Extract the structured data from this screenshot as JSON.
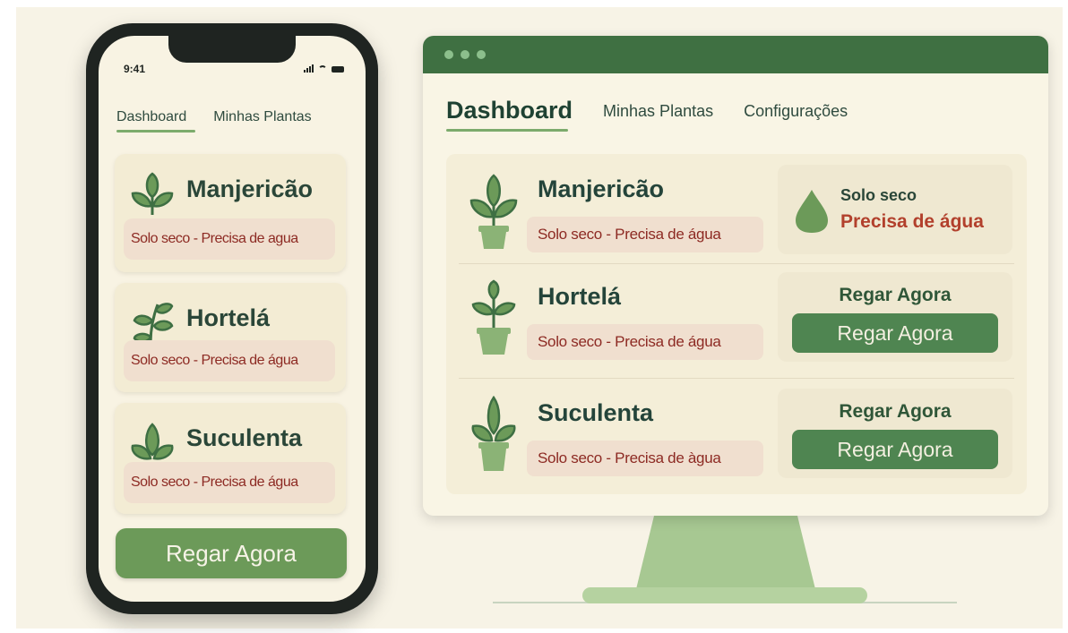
{
  "phone": {
    "status_bar": {
      "time": "9:41"
    },
    "tabs": [
      {
        "label": "Dashboard",
        "active": true
      },
      {
        "label": "Minhas Plantas",
        "active": false
      }
    ],
    "plants": [
      {
        "name": "Manjericão",
        "status": "Solo seco - Precisa de agua",
        "icon": "basil-leaf-icon"
      },
      {
        "name": "Hortelá",
        "status": "Solo seco - Precisa de água",
        "icon": "mint-leaf-icon"
      },
      {
        "name": "Suculenta",
        "status": "Solo seco - Precisa de água",
        "icon": "succulent-leaf-icon"
      }
    ],
    "action_button": "Regar Agora"
  },
  "desktop": {
    "tabs": [
      {
        "label": "Dashboard",
        "active": true
      },
      {
        "label": "Minhas Plantas",
        "active": false
      },
      {
        "label": "Configurações",
        "active": false
      }
    ],
    "plants": [
      {
        "name": "Manjericão",
        "status": "Solo seco - Precisa de água",
        "icon": "basil-pot-icon",
        "side": {
          "type": "alert",
          "icon": "water-drop-icon",
          "title": "Solo seco",
          "subtitle": "Precisa de água"
        }
      },
      {
        "name": "Hortelá",
        "status": "Solo seco - Precisa de água",
        "icon": "mint-pot-icon",
        "side": {
          "type": "action",
          "label": "Regar Agora",
          "button": "Regar Agora"
        }
      },
      {
        "name": "Suculenta",
        "status": "Solo seco - Precisa de àgua",
        "icon": "succulent-pot-icon",
        "side": {
          "type": "action",
          "label": "Regar Agora",
          "button": "Regar Agora"
        }
      }
    ]
  },
  "colors": {
    "primary_green": "#4f8551",
    "button_green": "#6c9a59",
    "titlebar_green": "#3f7042",
    "alert_text": "#8d2a23",
    "alert_bg": "#f0dfcf",
    "background": "#f7f3e6"
  }
}
